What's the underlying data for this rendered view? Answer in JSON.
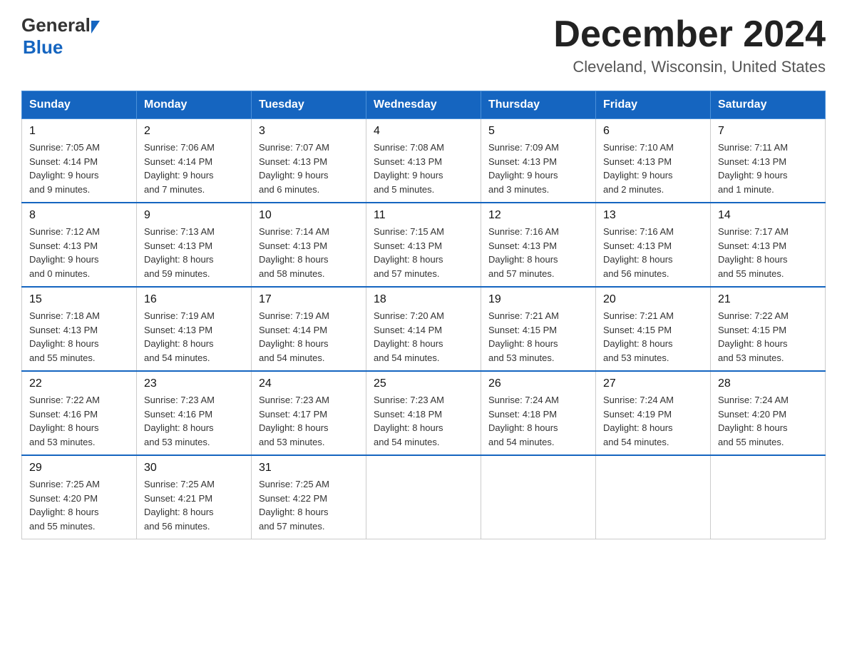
{
  "header": {
    "logo_general": "General",
    "logo_blue": "Blue",
    "main_title": "December 2024",
    "subtitle": "Cleveland, Wisconsin, United States"
  },
  "calendar": {
    "days_of_week": [
      "Sunday",
      "Monday",
      "Tuesday",
      "Wednesday",
      "Thursday",
      "Friday",
      "Saturday"
    ],
    "weeks": [
      [
        {
          "day": "1",
          "sunrise": "7:05 AM",
          "sunset": "4:14 PM",
          "daylight": "9 hours and 9 minutes."
        },
        {
          "day": "2",
          "sunrise": "7:06 AM",
          "sunset": "4:14 PM",
          "daylight": "9 hours and 7 minutes."
        },
        {
          "day": "3",
          "sunrise": "7:07 AM",
          "sunset": "4:13 PM",
          "daylight": "9 hours and 6 minutes."
        },
        {
          "day": "4",
          "sunrise": "7:08 AM",
          "sunset": "4:13 PM",
          "daylight": "9 hours and 5 minutes."
        },
        {
          "day": "5",
          "sunrise": "7:09 AM",
          "sunset": "4:13 PM",
          "daylight": "9 hours and 3 minutes."
        },
        {
          "day": "6",
          "sunrise": "7:10 AM",
          "sunset": "4:13 PM",
          "daylight": "9 hours and 2 minutes."
        },
        {
          "day": "7",
          "sunrise": "7:11 AM",
          "sunset": "4:13 PM",
          "daylight": "9 hours and 1 minute."
        }
      ],
      [
        {
          "day": "8",
          "sunrise": "7:12 AM",
          "sunset": "4:13 PM",
          "daylight": "9 hours and 0 minutes."
        },
        {
          "day": "9",
          "sunrise": "7:13 AM",
          "sunset": "4:13 PM",
          "daylight": "8 hours and 59 minutes."
        },
        {
          "day": "10",
          "sunrise": "7:14 AM",
          "sunset": "4:13 PM",
          "daylight": "8 hours and 58 minutes."
        },
        {
          "day": "11",
          "sunrise": "7:15 AM",
          "sunset": "4:13 PM",
          "daylight": "8 hours and 57 minutes."
        },
        {
          "day": "12",
          "sunrise": "7:16 AM",
          "sunset": "4:13 PM",
          "daylight": "8 hours and 57 minutes."
        },
        {
          "day": "13",
          "sunrise": "7:16 AM",
          "sunset": "4:13 PM",
          "daylight": "8 hours and 56 minutes."
        },
        {
          "day": "14",
          "sunrise": "7:17 AM",
          "sunset": "4:13 PM",
          "daylight": "8 hours and 55 minutes."
        }
      ],
      [
        {
          "day": "15",
          "sunrise": "7:18 AM",
          "sunset": "4:13 PM",
          "daylight": "8 hours and 55 minutes."
        },
        {
          "day": "16",
          "sunrise": "7:19 AM",
          "sunset": "4:13 PM",
          "daylight": "8 hours and 54 minutes."
        },
        {
          "day": "17",
          "sunrise": "7:19 AM",
          "sunset": "4:14 PM",
          "daylight": "8 hours and 54 minutes."
        },
        {
          "day": "18",
          "sunrise": "7:20 AM",
          "sunset": "4:14 PM",
          "daylight": "8 hours and 54 minutes."
        },
        {
          "day": "19",
          "sunrise": "7:21 AM",
          "sunset": "4:15 PM",
          "daylight": "8 hours and 53 minutes."
        },
        {
          "day": "20",
          "sunrise": "7:21 AM",
          "sunset": "4:15 PM",
          "daylight": "8 hours and 53 minutes."
        },
        {
          "day": "21",
          "sunrise": "7:22 AM",
          "sunset": "4:15 PM",
          "daylight": "8 hours and 53 minutes."
        }
      ],
      [
        {
          "day": "22",
          "sunrise": "7:22 AM",
          "sunset": "4:16 PM",
          "daylight": "8 hours and 53 minutes."
        },
        {
          "day": "23",
          "sunrise": "7:23 AM",
          "sunset": "4:16 PM",
          "daylight": "8 hours and 53 minutes."
        },
        {
          "day": "24",
          "sunrise": "7:23 AM",
          "sunset": "4:17 PM",
          "daylight": "8 hours and 53 minutes."
        },
        {
          "day": "25",
          "sunrise": "7:23 AM",
          "sunset": "4:18 PM",
          "daylight": "8 hours and 54 minutes."
        },
        {
          "day": "26",
          "sunrise": "7:24 AM",
          "sunset": "4:18 PM",
          "daylight": "8 hours and 54 minutes."
        },
        {
          "day": "27",
          "sunrise": "7:24 AM",
          "sunset": "4:19 PM",
          "daylight": "8 hours and 54 minutes."
        },
        {
          "day": "28",
          "sunrise": "7:24 AM",
          "sunset": "4:20 PM",
          "daylight": "8 hours and 55 minutes."
        }
      ],
      [
        {
          "day": "29",
          "sunrise": "7:25 AM",
          "sunset": "4:20 PM",
          "daylight": "8 hours and 55 minutes."
        },
        {
          "day": "30",
          "sunrise": "7:25 AM",
          "sunset": "4:21 PM",
          "daylight": "8 hours and 56 minutes."
        },
        {
          "day": "31",
          "sunrise": "7:25 AM",
          "sunset": "4:22 PM",
          "daylight": "8 hours and 57 minutes."
        },
        null,
        null,
        null,
        null
      ]
    ],
    "labels": {
      "sunrise": "Sunrise:",
      "sunset": "Sunset:",
      "daylight": "Daylight:"
    }
  }
}
